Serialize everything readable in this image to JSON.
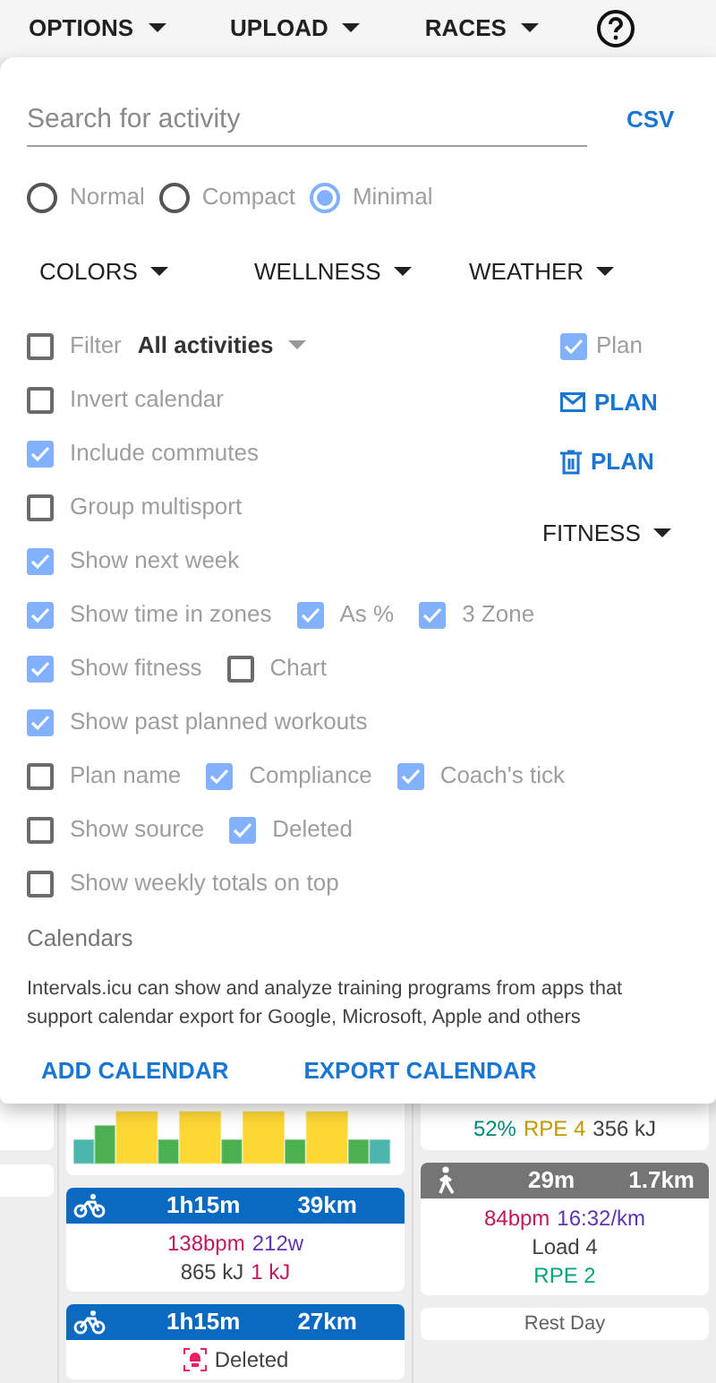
{
  "menu_bar": [
    {
      "label": "OPTIONS"
    },
    {
      "label": "UPLOAD"
    },
    {
      "label": "RACES"
    }
  ],
  "panel": {
    "search": {
      "placeholder": "Search for activity"
    },
    "csv_button": "CSV",
    "view_modes": [
      {
        "label": "Normal",
        "selected": false
      },
      {
        "label": "Compact",
        "selected": false
      },
      {
        "label": "Minimal",
        "selected": true
      }
    ],
    "dropdowns": [
      "COLORS",
      "WELLNESS",
      "WEATHER"
    ],
    "filter": {
      "label": "Filter",
      "checked": false,
      "value": "All activities"
    },
    "top_options": [
      {
        "label": "Invert calendar",
        "checked": false
      },
      {
        "label": "Include commutes",
        "checked": true
      },
      {
        "label": "Group multisport",
        "checked": false
      },
      {
        "label": "Show next week",
        "checked": true
      }
    ],
    "plan_checkbox": {
      "label": "Plan",
      "checked": true
    },
    "plan_actions": [
      {
        "kind": "email",
        "label": "PLAN"
      },
      {
        "kind": "delete",
        "label": "PLAN"
      }
    ],
    "fitness_dropdown": "FITNESS",
    "option_rows": [
      [
        {
          "label": "Show time in zones",
          "checked": true
        },
        {
          "label": "As %",
          "checked": true
        },
        {
          "label": "3 Zone",
          "checked": true
        }
      ],
      [
        {
          "label": "Show fitness",
          "checked": true
        },
        {
          "label": "Chart",
          "checked": false
        }
      ],
      [
        {
          "label": "Show past planned workouts",
          "checked": true
        }
      ],
      [
        {
          "label": "Plan name",
          "checked": false
        },
        {
          "label": "Compliance",
          "checked": true
        },
        {
          "label": "Coach's tick",
          "checked": true
        }
      ],
      [
        {
          "label": "Show source",
          "checked": false
        },
        {
          "label": "Deleted",
          "checked": true
        }
      ],
      [
        {
          "label": "Show weekly totals on top",
          "checked": false
        }
      ]
    ],
    "calendars": {
      "title": "Calendars",
      "description": "Intervals.icu can show and analyze training programs from apps that support calendar export for Google, Microsoft, Apple and others",
      "buttons": [
        "ADD CALENDAR",
        "EXPORT CALENDAR"
      ]
    }
  },
  "calendar": {
    "middle_column": [
      {
        "kind": "ride",
        "duration": "1h15m",
        "distance": "39km",
        "lines": [
          [
            {
              "text": "138bpm",
              "color": "#c2185b"
            },
            {
              "text": "212w",
              "color": "#5e35b1"
            }
          ],
          [
            {
              "text": "865 kJ",
              "color": "#424242"
            },
            {
              "text": "1 kJ",
              "color": "#c2185b"
            }
          ]
        ]
      },
      {
        "kind": "ride",
        "duration": "1h15m",
        "distance": "27km",
        "deleted": "Deleted"
      }
    ],
    "right_column": {
      "partial_line": [
        {
          "text": "52%",
          "color": "#00897b"
        },
        {
          "text": "RPE 4",
          "color": "#c29a00"
        },
        {
          "text": "356 kJ",
          "color": "#424242"
        }
      ],
      "walk": {
        "duration": "29m",
        "distance": "1.7km",
        "lines": [
          [
            {
              "text": "84bpm",
              "color": "#c2185b"
            },
            {
              "text": "16:32/km",
              "color": "#5e35b1"
            }
          ],
          [
            {
              "text": "Load 4",
              "color": "#424242"
            }
          ],
          [
            {
              "text": "RPE 2",
              "color": "#00a37a"
            }
          ]
        ]
      },
      "rest_day": "Rest Day"
    }
  }
}
